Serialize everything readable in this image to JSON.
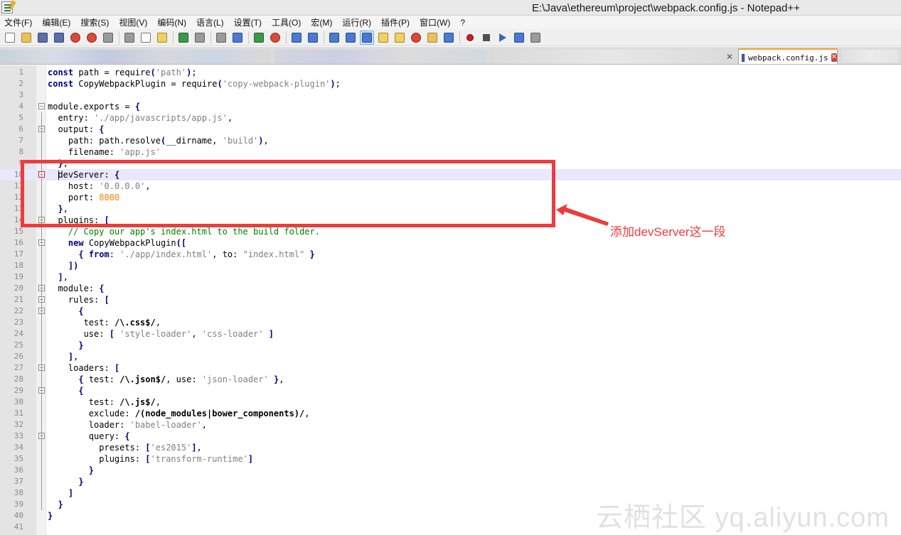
{
  "window": {
    "title": "E:\\Java\\ethereum\\project\\webpack.config.js - Notepad++"
  },
  "menu": [
    "文件(F)",
    "编辑(E)",
    "搜索(S)",
    "视图(V)",
    "编码(N)",
    "语言(L)",
    "设置(T)",
    "工具(O)",
    "宏(M)",
    "运行(R)",
    "插件(P)",
    "窗口(W)",
    "?"
  ],
  "toolbar": {
    "icons": [
      "new-file-icon",
      "open-file-icon",
      "save-icon",
      "save-all-icon",
      "close-icon",
      "close-all-icon",
      "print-icon",
      "cut-icon",
      "copy-icon",
      "paste-icon",
      "undo-icon",
      "redo-icon",
      "find-icon",
      "replace-icon",
      "zoom-in-icon",
      "zoom-out-icon",
      "sync-vertical-icon",
      "sync-horizontal-icon",
      "word-wrap-icon",
      "show-all-chars-icon",
      "indent-guide-icon",
      "user-language-icon",
      "function-list-icon",
      "doc-map-icon",
      "folder-workspace-icon",
      "monitor-icon",
      "record-macro-icon",
      "stop-record-icon",
      "play-macro-icon",
      "run-macro-multiple-icon",
      "save-macro-icon"
    ]
  },
  "tabs": {
    "active_label": "webpack.config.js",
    "close_symbol": "✕",
    "prev_close_symbol": "✕"
  },
  "editor": {
    "current_line": 10,
    "lines": [
      "const path = require('path');",
      "const CopyWebpackPlugin = require('copy-webpack-plugin');",
      "",
      "module.exports = {",
      "  entry: './app/javascripts/app.js',",
      "  output: {",
      "    path: path.resolve(__dirname, 'build'),",
      "    filename: 'app.js'",
      "  },",
      "  devServer: {",
      "    host: '0.0.0.0',",
      "    port: 8080",
      "  },",
      "  plugins: [",
      "    // Copy our app's index.html to the build folder.",
      "    new CopyWebpackPlugin([",
      "      { from: './app/index.html', to: \"index.html\" }",
      "    ])",
      "  ],",
      "  module: {",
      "    rules: [",
      "      {",
      "       test: /\\.css$/,",
      "       use: [ 'style-loader', 'css-loader' ]",
      "      }",
      "    ],",
      "    loaders: [",
      "      { test: /\\.json$/, use: 'json-loader' },",
      "      {",
      "        test: /\\.js$/,",
      "        exclude: /(node_modules|bower_components)/,",
      "        loader: 'babel-loader',",
      "        query: {",
      "          presets: ['es2015'],",
      "          plugins: ['transform-runtime']",
      "        }",
      "      }",
      "    ]",
      "  }",
      "}",
      ""
    ]
  },
  "annotation": {
    "text": "添加devServer这一段",
    "color": "#ef3b3b"
  },
  "watermark": {
    "text": "云栖社区 yq.aliyun.com"
  }
}
